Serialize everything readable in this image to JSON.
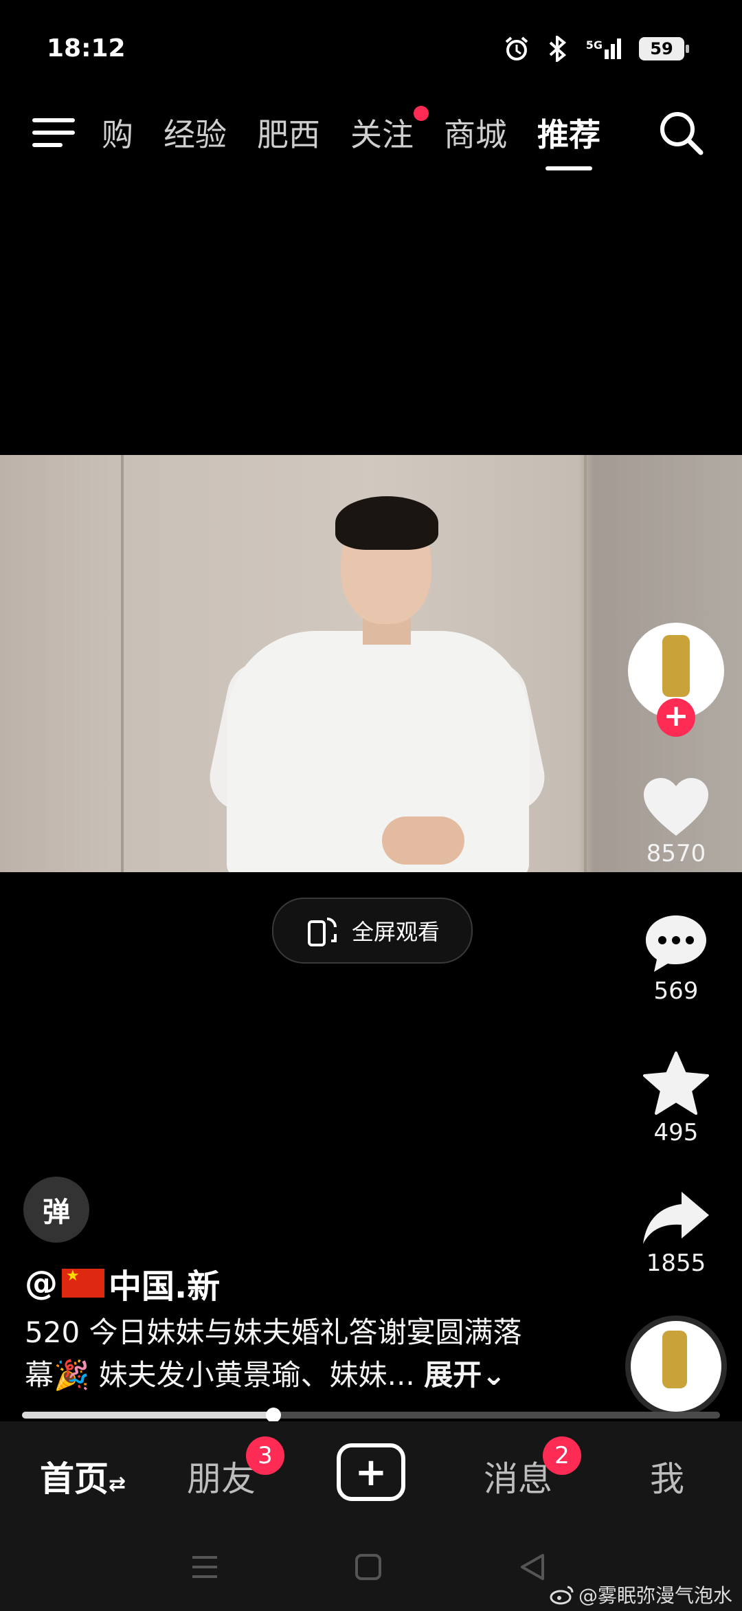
{
  "status_bar": {
    "time": "18:12",
    "network": "5G",
    "battery": "59"
  },
  "top_nav": {
    "tabs": [
      {
        "label": "购",
        "active": false,
        "dot": false
      },
      {
        "label": "经验",
        "active": false,
        "dot": false
      },
      {
        "label": "肥西",
        "active": false,
        "dot": false
      },
      {
        "label": "关注",
        "active": false,
        "dot": true
      },
      {
        "label": "商城",
        "active": false,
        "dot": false
      },
      {
        "label": "推荐",
        "active": true,
        "dot": false
      }
    ]
  },
  "fullscreen_label": "全屏观看",
  "rail": {
    "likes": "8570",
    "comments": "569",
    "favorites": "495",
    "shares": "1855"
  },
  "danmaku_label": "弹",
  "author": {
    "at": "@",
    "name": "中国.新"
  },
  "caption": {
    "line1": "520 今日妹妹与妹夫婚礼答谢宴圆满落",
    "line2": "幕🎉 妹夫发小黄景瑜、妹妹...",
    "expand": "展开"
  },
  "progress_fraction": 0.36,
  "bottom_nav": {
    "home": "首页",
    "friends": "朋友",
    "friends_badge": "3",
    "create": "+",
    "messages": "消息",
    "messages_badge": "2",
    "me": "我"
  },
  "watermark": "@雾眠弥漫气泡水",
  "colors": {
    "accent": "#fe2c55",
    "background": "#000000"
  }
}
